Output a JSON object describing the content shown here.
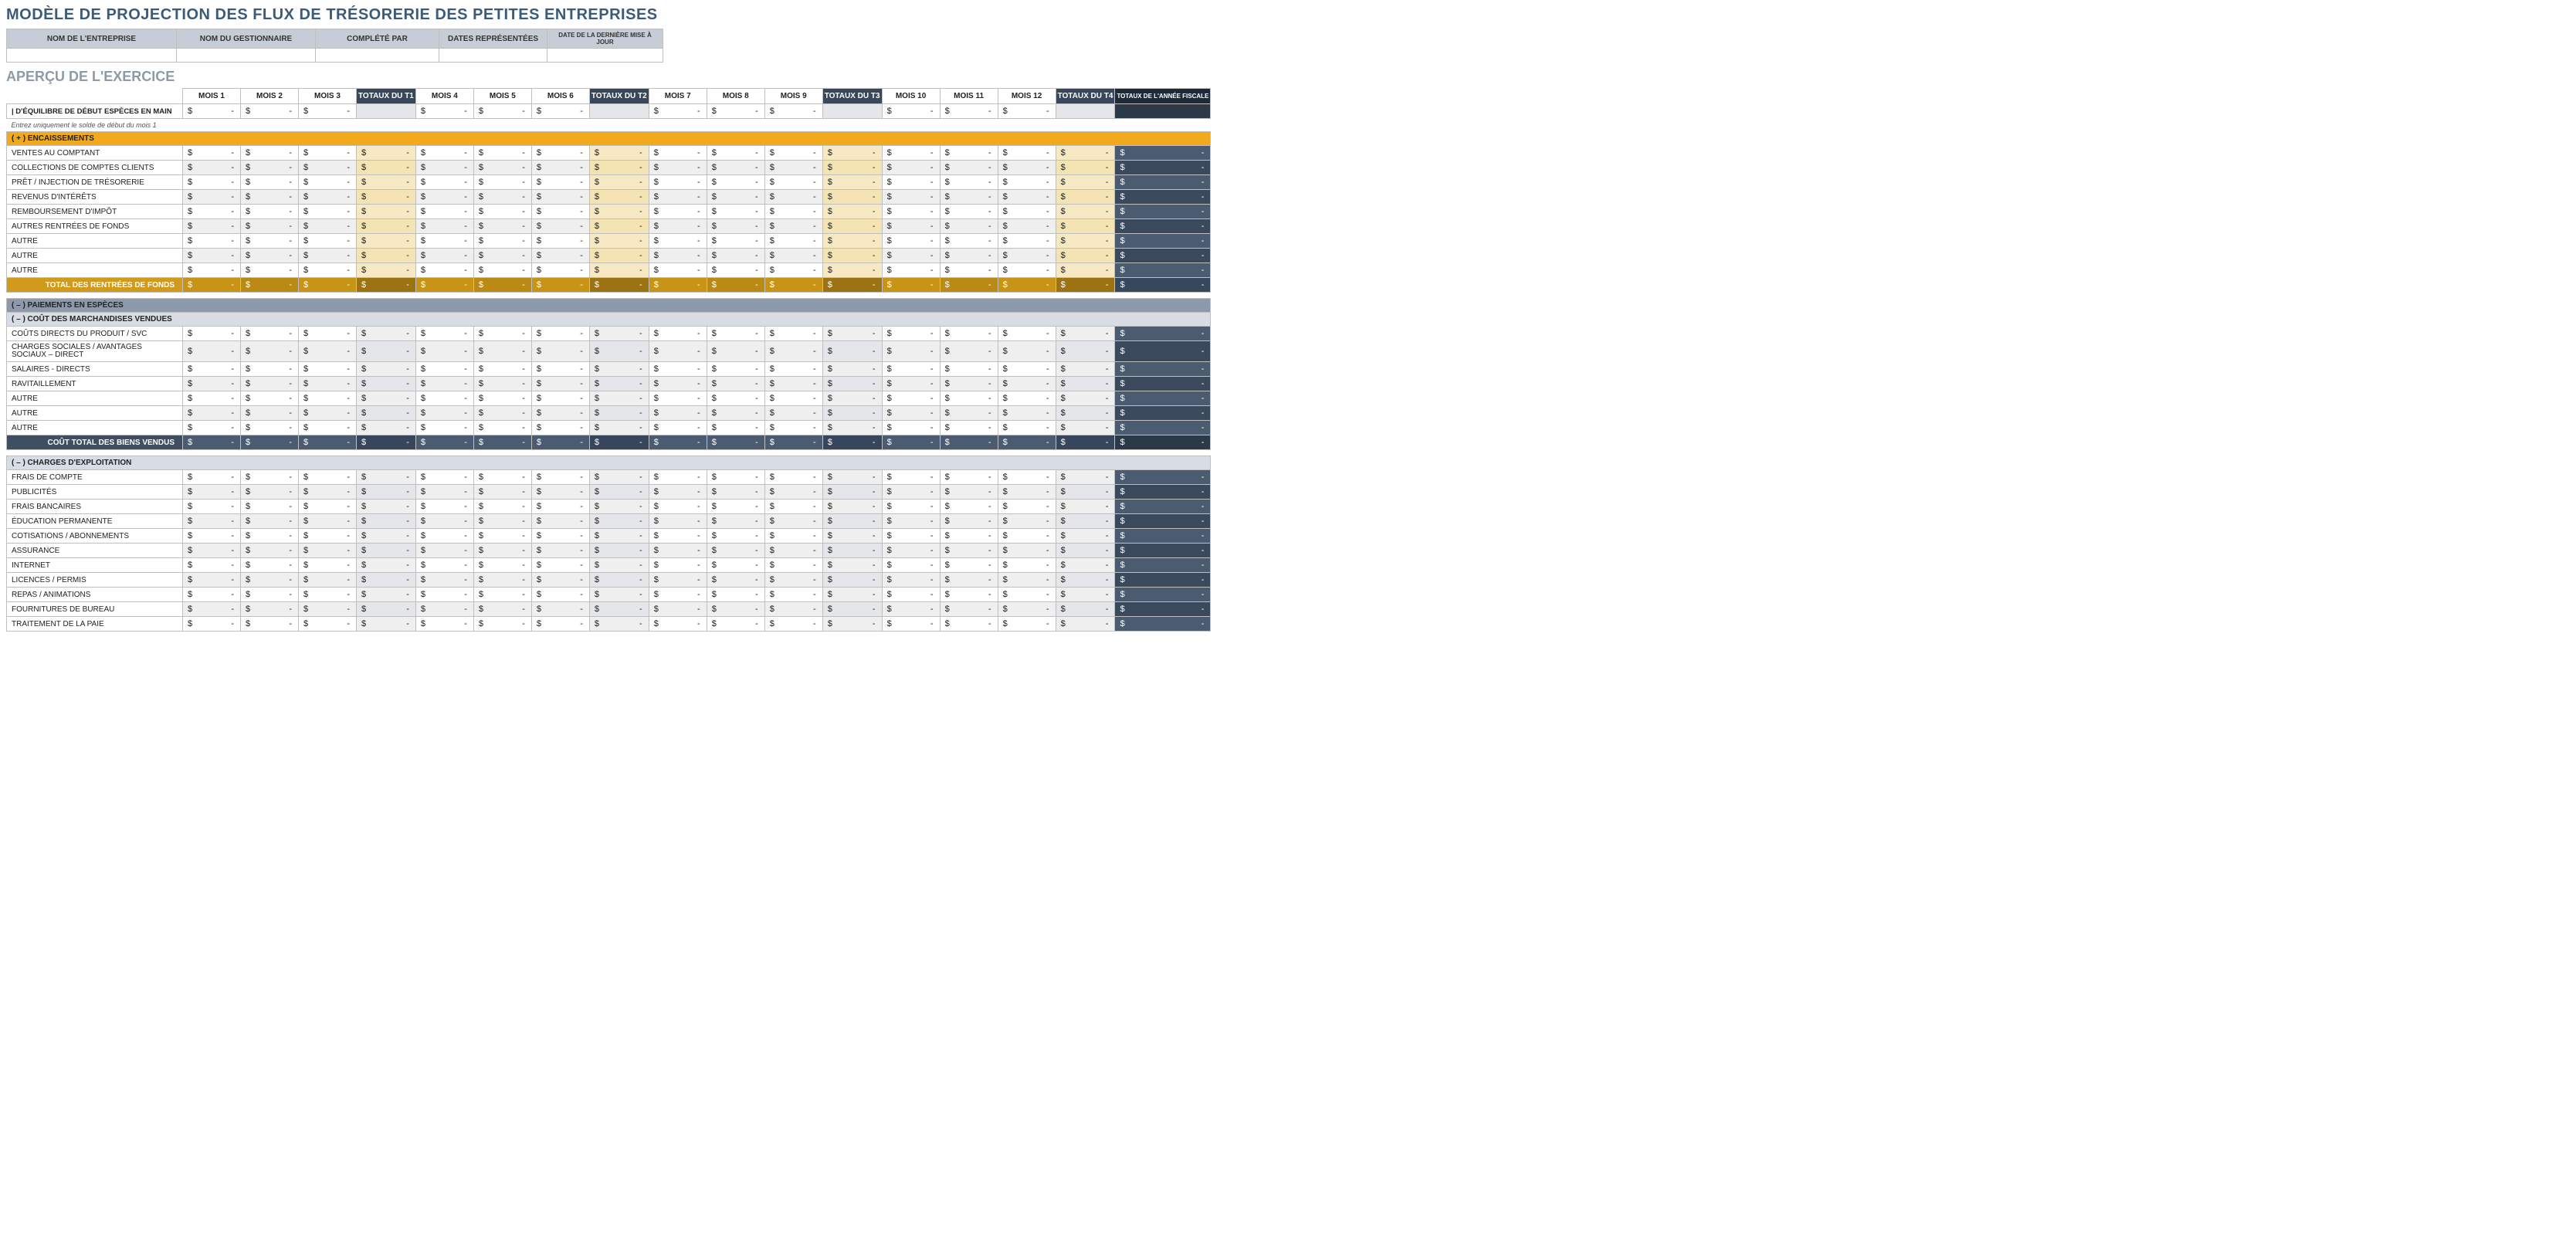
{
  "title": "MODÈLE DE PROJECTION DES FLUX DE TRÉSORERIE DES PETITES ENTREPRISES",
  "info_headers": {
    "company": "NOM DE L'ENTREPRISE",
    "manager": "NOM DU GESTIONNAIRE",
    "completed_by": "COMPLÉTÉ PAR",
    "dates": "DATES REPRÉSENTÉES",
    "last_update": "DATE DE LA DERNIÈRE MISE À JOUR"
  },
  "info_values": {
    "company": "",
    "manager": "",
    "completed_by": "",
    "dates": "",
    "last_update": ""
  },
  "overview_title": "APERÇU DE L'EXERCICE",
  "columns": [
    {
      "key": "m1",
      "label": "MOIS 1",
      "type": "m"
    },
    {
      "key": "m2",
      "label": "MOIS 2",
      "type": "m"
    },
    {
      "key": "m3",
      "label": "MOIS 3",
      "type": "m"
    },
    {
      "key": "q1",
      "label": "TOTAUX DU T1",
      "type": "q"
    },
    {
      "key": "m4",
      "label": "MOIS 4",
      "type": "m"
    },
    {
      "key": "m5",
      "label": "MOIS 5",
      "type": "m"
    },
    {
      "key": "m6",
      "label": "MOIS 6",
      "type": "m"
    },
    {
      "key": "q2",
      "label": "TOTAUX DU T2",
      "type": "q"
    },
    {
      "key": "m7",
      "label": "MOIS 7",
      "type": "m"
    },
    {
      "key": "m8",
      "label": "MOIS 8",
      "type": "m"
    },
    {
      "key": "m9",
      "label": "MOIS 9",
      "type": "m"
    },
    {
      "key": "q3",
      "label": "TOTAUX DU T3",
      "type": "q"
    },
    {
      "key": "m10",
      "label": "MOIS 10",
      "type": "m"
    },
    {
      "key": "m11",
      "label": "MOIS 11",
      "type": "m"
    },
    {
      "key": "m12",
      "label": "MOIS 12",
      "type": "m"
    },
    {
      "key": "q4",
      "label": "TOTAUX DU T4",
      "type": "q"
    },
    {
      "key": "fy",
      "label": "TOTAUX DE L'ANNÉE FISCALE",
      "type": "fy"
    }
  ],
  "balance_row_label": "D'ÉQUILIBRE DE DÉBUT ESPÈCES EN MAIN",
  "balance_hint": "Entrez uniquement le solde de début du mois 1",
  "sections": {
    "receipts": {
      "header": "( + )  ENCAISSEMENTS",
      "rows": [
        "VENTES AU COMPTANT",
        "COLLECTIONS DE COMPTES CLIENTS",
        "PRÊT / INJECTION DE TRÉSORERIE",
        "REVENUS D'INTÉRÊTS",
        "REMBOURSEMENT D'IMPÔT",
        "AUTRES RENTRÉES DE FONDS",
        "AUTRE",
        "AUTRE",
        "AUTRE"
      ],
      "total_label": "TOTAL DES RENTRÉES DE FONDS"
    },
    "cash_payments_header": "( – )  PAIEMENTS EN ESPÈCES",
    "cogs": {
      "header": "( – )  COÛT DES MARCHANDISES VENDUES",
      "rows": [
        "COÛTS DIRECTS DU PRODUIT / SVC",
        "CHARGES SOCIALES / AVANTAGES SOCIAUX – DIRECT",
        "SALAIRES - DIRECTS",
        "RAVITAILLEMENT",
        "AUTRE",
        "AUTRE",
        "AUTRE"
      ],
      "total_label": "COÛT TOTAL DES BIENS VENDUS"
    },
    "opex": {
      "header": "( – )  CHARGES D'EXPLOITATION",
      "rows": [
        "FRAIS DE COMPTE",
        "PUBLICITÉS",
        "FRAIS BANCAIRES",
        "ÉDUCATION PERMANENTE",
        "COTISATIONS / ABONNEMENTS",
        "ASSURANCE",
        "INTERNET",
        "LICENCES / PERMIS",
        "REPAS / ANIMATIONS",
        "FOURNITURES DE BUREAU",
        "TRAITEMENT DE LA PAIE"
      ]
    }
  }
}
